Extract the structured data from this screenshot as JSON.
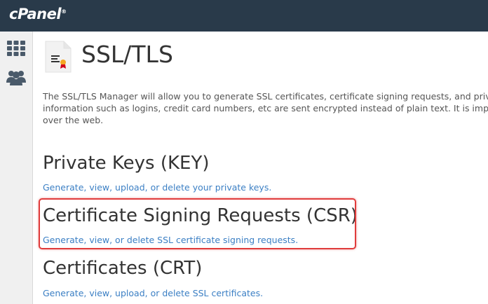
{
  "header": {
    "logo_text": "cPanel",
    "logo_mark": "®",
    "bg_color": "#293a4a"
  },
  "sidebar": {
    "items": [
      {
        "icon": "grid-icon"
      },
      {
        "icon": "users-icon"
      }
    ]
  },
  "page": {
    "title": "SSL/TLS",
    "icon": "certificate-document-icon",
    "description_lines": [
      "The SSL/TLS Manager will allow you to generate SSL certificates, certificate signing requests, and private",
      "information such as logins, credit card numbers, etc are sent encrypted instead of plain text. It is importa",
      "over the web."
    ]
  },
  "sections": [
    {
      "title": "Private Keys (KEY)",
      "link": "Generate, view, upload, or delete your private keys."
    },
    {
      "title": "Certificate Signing Requests (CSR)",
      "link": "Generate, view, or delete SSL certificate signing requests.",
      "highlighted": true
    },
    {
      "title": "Certificates (CRT)",
      "link": "Generate, view, upload, or delete SSL certificates."
    }
  ],
  "colors": {
    "link": "#3b7fc4",
    "highlight": "#e03c3c"
  }
}
